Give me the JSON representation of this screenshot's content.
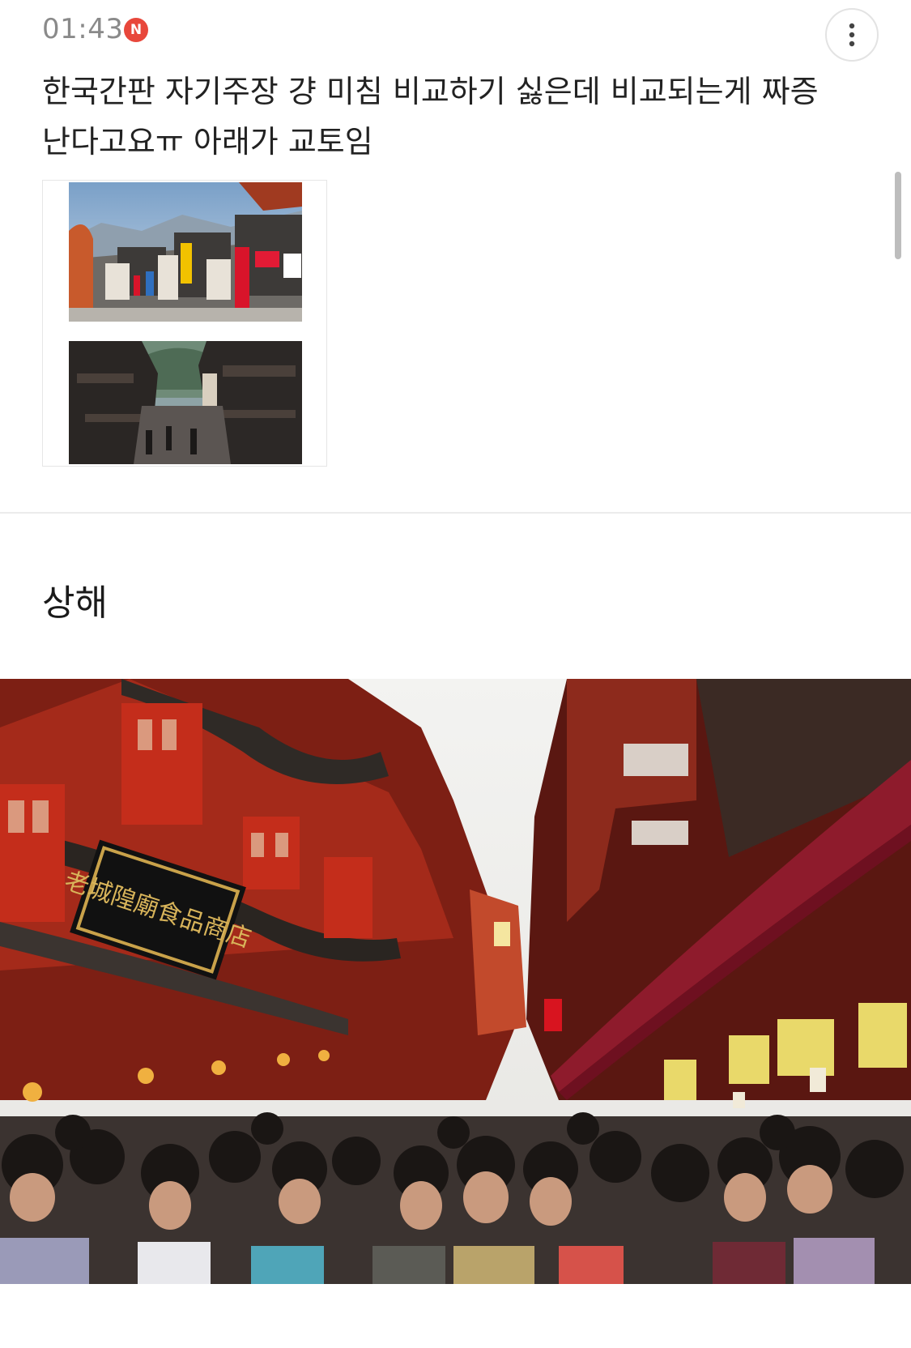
{
  "status": {
    "time": "01:43",
    "new_badge": "N"
  },
  "post": {
    "title": "한국간판 자기주장 걍 미침 비교하기 싫은데 비교되는게 짜증난다고요ㅠ 아래가 교토임",
    "section_heading": "상해"
  },
  "icons": {
    "more": "more-vertical-icon"
  },
  "sign_on_hero": "老城隍廟食品商店",
  "colors": {
    "badge": "#e8473b",
    "timestamp": "#8a8a8a",
    "divider": "#ececec"
  }
}
